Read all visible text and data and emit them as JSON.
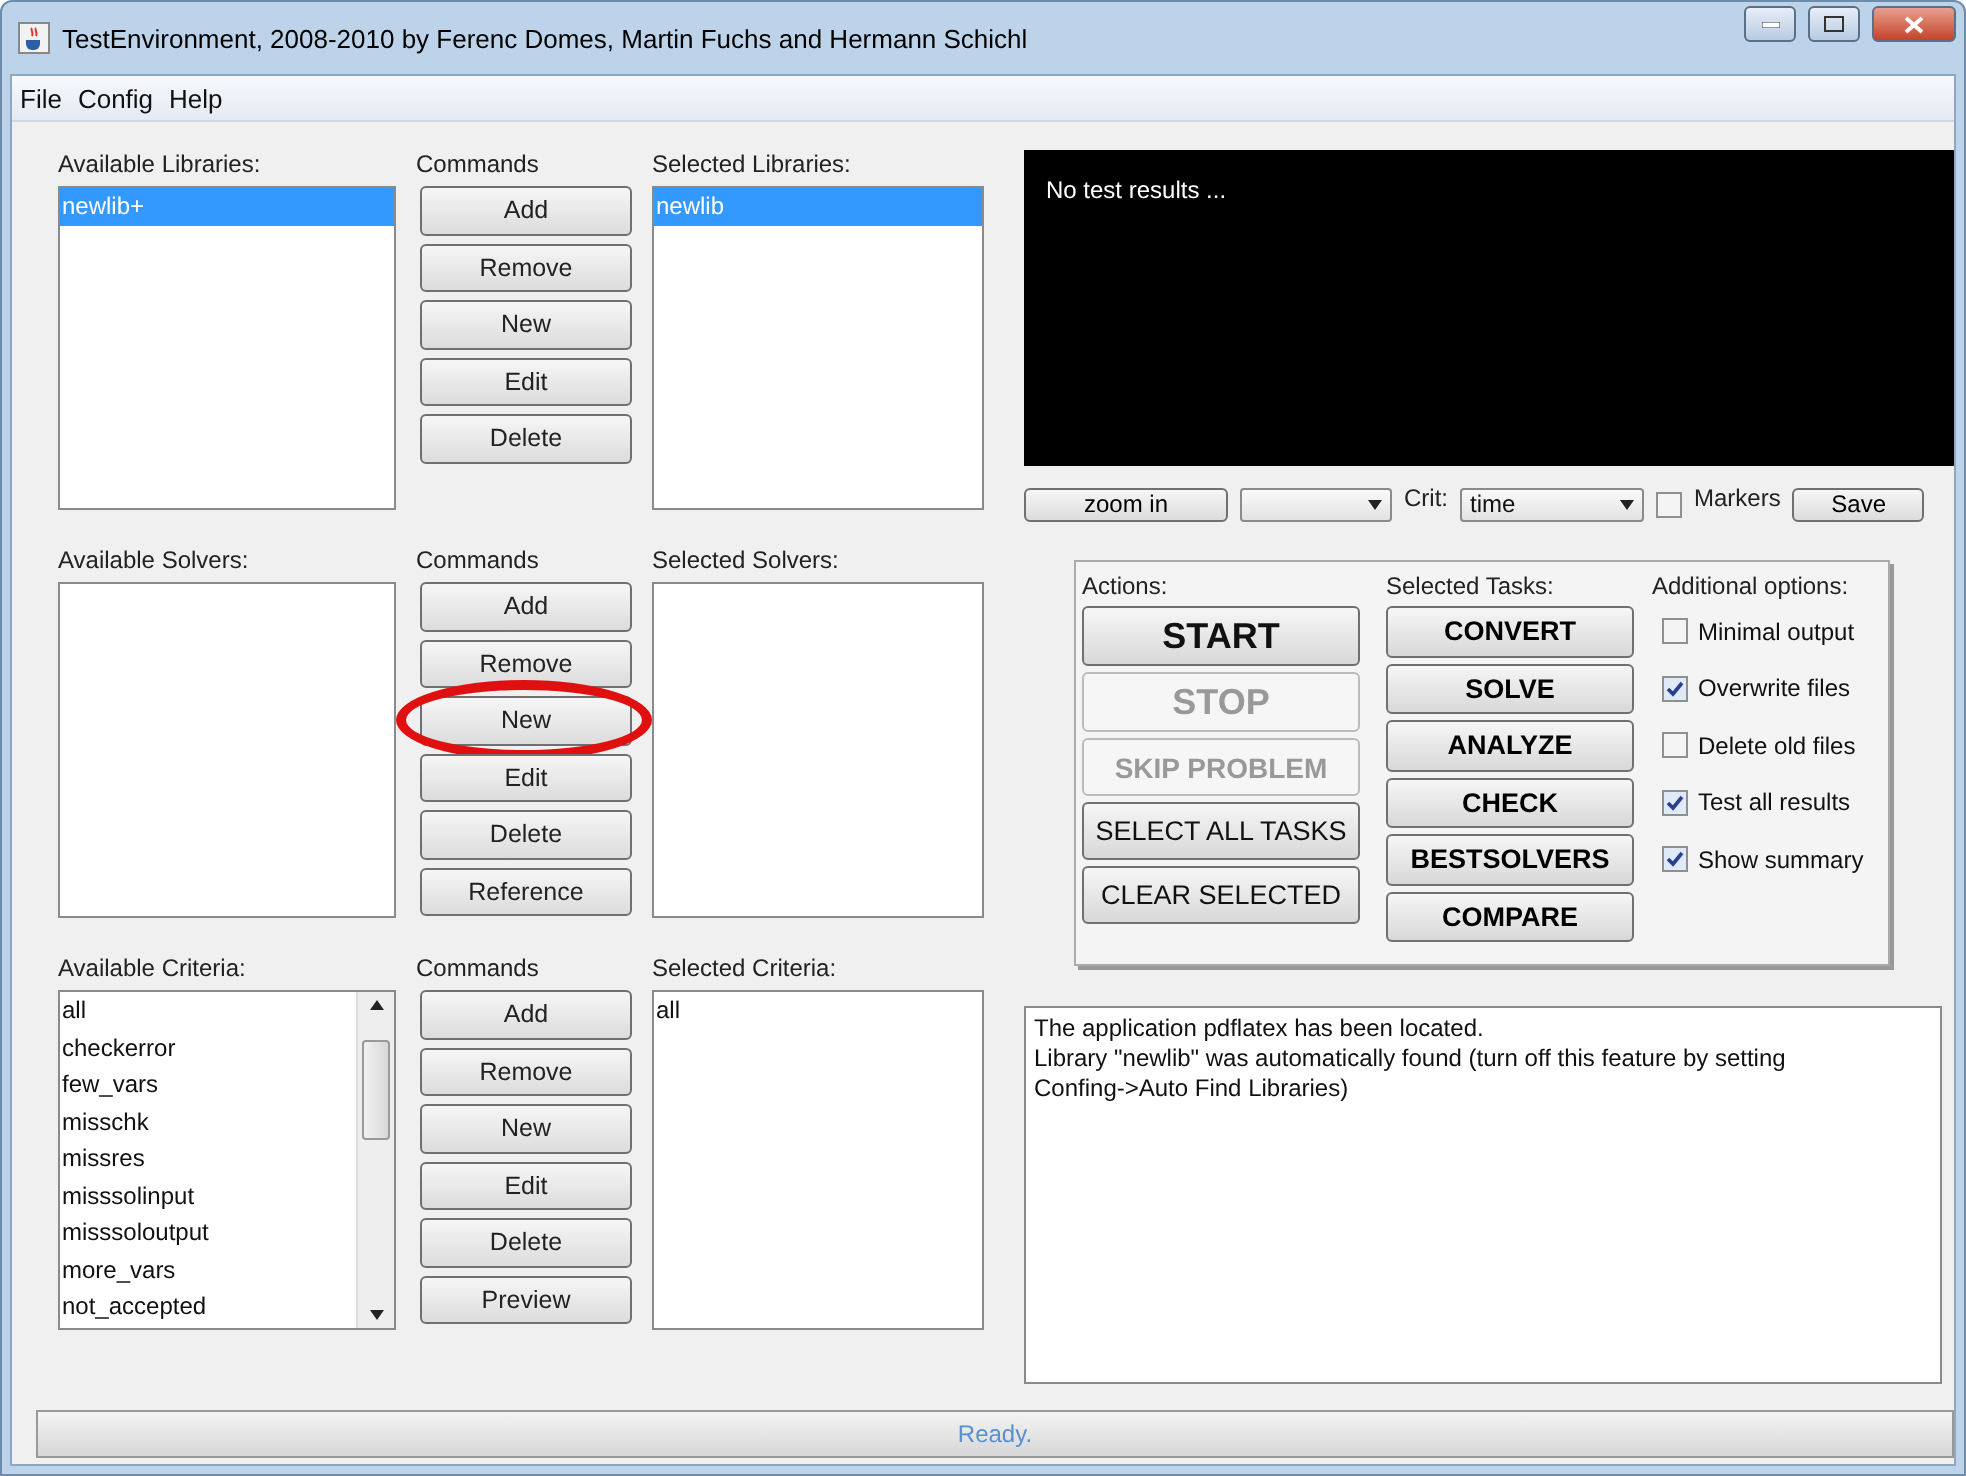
{
  "window": {
    "title": "TestEnvironment, 2008-2010 by Ferenc Domes, Martin Fuchs and Hermann Schichl"
  },
  "menu": [
    "File",
    "Config",
    "Help"
  ],
  "sections": [
    {
      "available_label": "Available Libraries:",
      "commands_label": "Commands",
      "selected_label": "Selected Libraries:",
      "available": [
        {
          "text": "newlib+",
          "selected": true
        }
      ],
      "commands": [
        {
          "label": "Add",
          "highlighted": false
        },
        {
          "label": "Remove",
          "highlighted": false
        },
        {
          "label": "New",
          "highlighted": false
        },
        {
          "label": "Edit",
          "highlighted": false
        },
        {
          "label": "Delete",
          "highlighted": false
        }
      ],
      "selected": [
        {
          "text": "newlib",
          "selected": true
        }
      ]
    },
    {
      "available_label": "Available Solvers:",
      "commands_label": "Commands",
      "selected_label": "Selected Solvers:",
      "commands": [
        {
          "label": "Add",
          "highlighted": false
        },
        {
          "label": "Remove",
          "highlighted": false
        },
        {
          "label": "New",
          "highlighted": true
        },
        {
          "label": "Edit",
          "highlighted": false
        },
        {
          "label": "Delete",
          "highlighted": false
        },
        {
          "label": "Reference",
          "highlighted": false
        }
      ]
    },
    {
      "available_label": "Available Criteria:",
      "commands_label": "Commands",
      "selected_label": "Selected Criteria:",
      "available": [
        {
          "text": "all",
          "selected": false
        },
        {
          "text": "checkerror",
          "selected": false
        },
        {
          "text": "few_vars",
          "selected": false
        },
        {
          "text": "misschk",
          "selected": false
        },
        {
          "text": "missres",
          "selected": false
        },
        {
          "text": "misssolinput",
          "selected": false
        },
        {
          "text": "misssoloutput",
          "selected": false
        },
        {
          "text": "more_vars",
          "selected": false
        },
        {
          "text": "not_accepted",
          "selected": false
        }
      ],
      "commands": [
        {
          "label": "Add",
          "highlighted": false
        },
        {
          "label": "Remove",
          "highlighted": false
        },
        {
          "label": "New",
          "highlighted": false
        },
        {
          "label": "Edit",
          "highlighted": false
        },
        {
          "label": "Delete",
          "highlighted": false
        },
        {
          "label": "Preview",
          "highlighted": false
        }
      ],
      "selected": [
        {
          "text": "all",
          "selected": false
        }
      ]
    }
  ],
  "output": {
    "text": "No test results ..."
  },
  "plot_toolbar": {
    "zoom_button": "zoom in",
    "crit_label": "Crit:",
    "crit_value": "time",
    "markers": {
      "label": "Markers",
      "checked": false
    },
    "save_button": "Save"
  },
  "actions": {
    "label": "Actions:",
    "buttons": [
      {
        "label": "START",
        "kind": "large",
        "disabled": false
      },
      {
        "label": "STOP",
        "kind": "large",
        "disabled": true
      },
      {
        "label": "SKIP PROBLEM",
        "kind": "bold",
        "disabled": true
      },
      {
        "label": "SELECT ALL TASKS",
        "kind": "plain",
        "disabled": false
      },
      {
        "label": "CLEAR SELECTED",
        "kind": "plain",
        "disabled": false
      }
    ]
  },
  "tasks": {
    "label": "Selected Tasks:",
    "buttons": [
      "CONVERT",
      "SOLVE",
      "ANALYZE",
      "CHECK",
      "BESTSOLVERS",
      "COMPARE"
    ]
  },
  "options": {
    "label": "Additional options:",
    "items": [
      {
        "label": "Minimal output",
        "checked": false
      },
      {
        "label": "Overwrite files",
        "checked": true
      },
      {
        "label": "Delete old files",
        "checked": false
      },
      {
        "label": "Test all results",
        "checked": true
      },
      {
        "label": "Show summary",
        "checked": true
      }
    ]
  },
  "log": [
    "The application pdflatex has been located.",
    "Library \"newlib\" was automatically found (turn off this feature by setting Confing->Auto Find Libraries)"
  ],
  "status": "Ready."
}
